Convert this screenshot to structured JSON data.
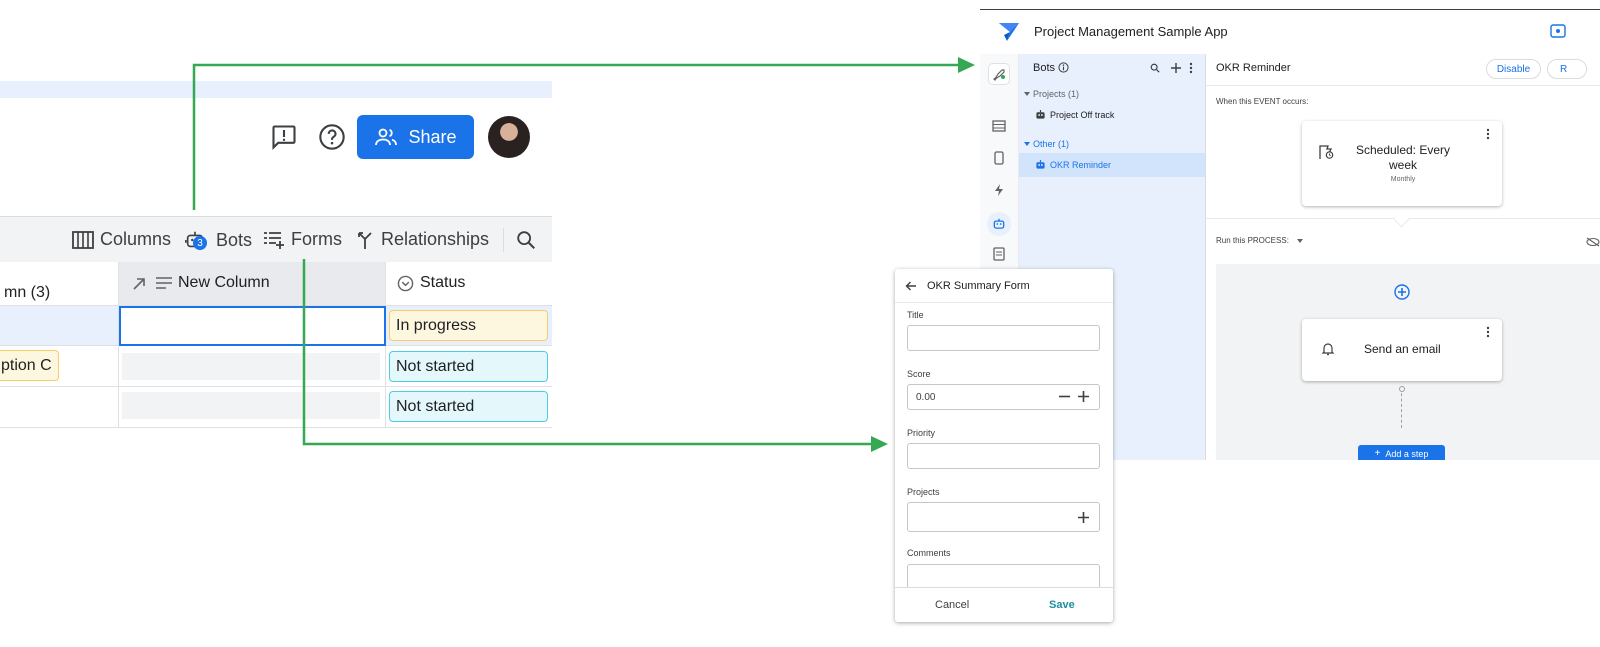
{
  "left": {
    "share_label": "Share",
    "toolbar": {
      "columns": "Columns",
      "bots": "Bots",
      "bots_badge": "3",
      "forms": "Forms",
      "relationships": "Relationships"
    },
    "headers": {
      "col1": "mn (3)",
      "new_column": "New Column",
      "status": "Status"
    },
    "rows": [
      {
        "option": "",
        "status": "In progress"
      },
      {
        "option": "ption C",
        "status": "Not started"
      },
      {
        "option": "",
        "status": "Not started"
      }
    ]
  },
  "form": {
    "title": "OKR Summary Form",
    "fields": {
      "title_label": "Title",
      "score_label": "Score",
      "score_value": "0.00",
      "priority_label": "Priority",
      "projects_label": "Projects",
      "comments_label": "Comments"
    },
    "cancel": "Cancel",
    "save": "Save"
  },
  "editor": {
    "app_title": "Project Management Sample App",
    "bots_title": "Bots",
    "groups": [
      {
        "label": "Projects (1)",
        "item": "Project Off track"
      },
      {
        "label": "Other (1)",
        "item": "OKR Reminder"
      }
    ],
    "detail_title": "OKR Reminder",
    "disable": "Disable",
    "right_btn": "R",
    "event_label": "When this EVENT occurs:",
    "event_card_title": "Scheduled: Every week",
    "event_card_sub": "Monthly",
    "process_label": "Run this PROCESS:",
    "step_title": "Send an email",
    "add_step": "Add a step"
  },
  "colors": {
    "primary": "#1a73e8",
    "arrow": "#34a853",
    "in_progress_bg": "#fef7e0",
    "in_progress_border": "#f9cb6b",
    "not_started_bg": "#e4f7fb",
    "not_started_border": "#4ecde6",
    "save_teal": "#1e8e9e"
  }
}
